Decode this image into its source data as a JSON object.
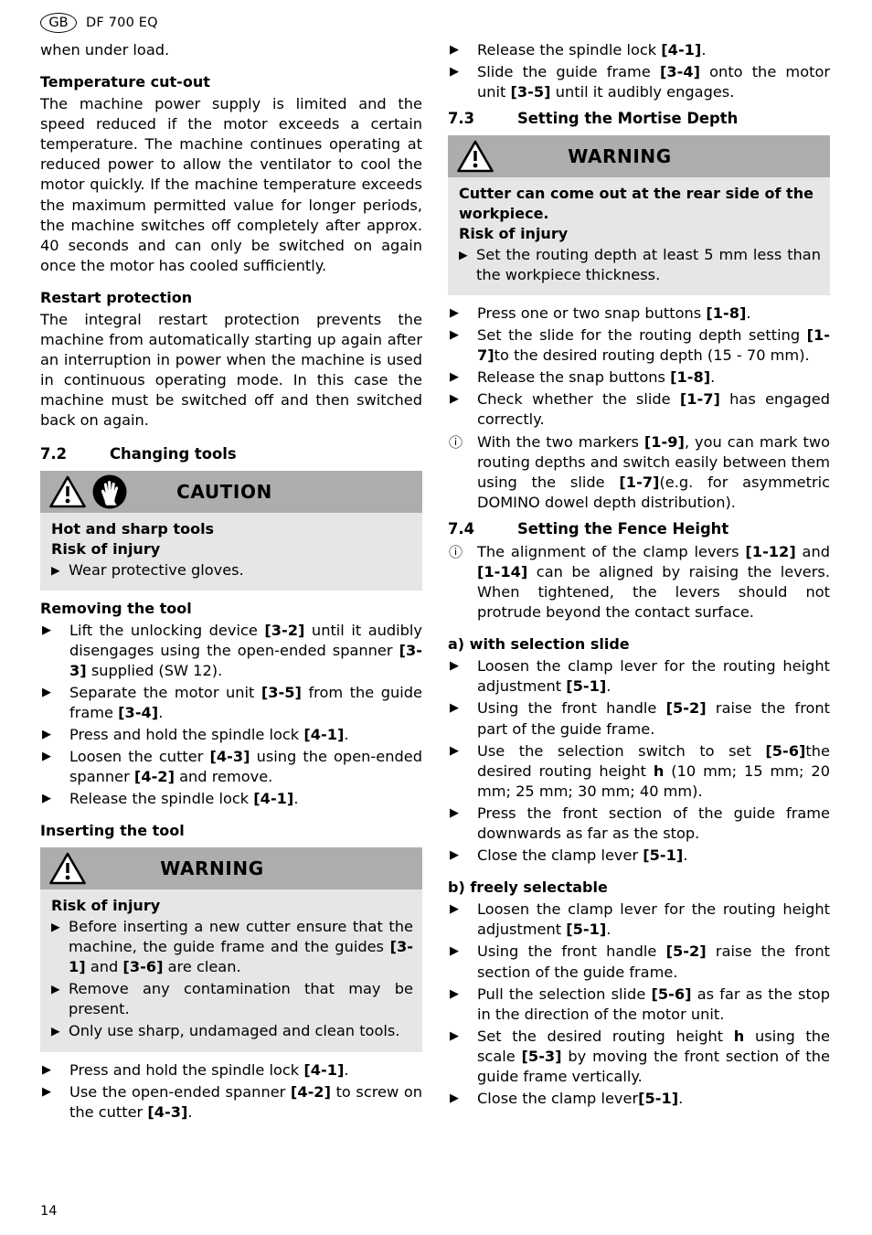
{
  "header": {
    "locale_code": "GB",
    "model": "DF 700 EQ"
  },
  "page_number": "14",
  "colors": {
    "alert_header_bg": "#adadad",
    "alert_body_bg": "#e6e6e6",
    "text": "#000000"
  },
  "left_column": {
    "continued_text": "when under load.",
    "temperature_cutout": {
      "heading": "Temperature cut-out",
      "paragraph": "The machine power supply is limited and the speed reduced if the motor exceeds a certain temperature. The machine continues operating at reduced power to allow the ventilator to cool the motor quickly. If the machine temperature exceeds the maximum permitted value for longer periods, the machine switches off completely after approx. 40 seconds and can only be switched on again once the motor has cooled sufficiently."
    },
    "restart_protection": {
      "heading": "Restart protection",
      "paragraph": "The integral restart protection prevents the machine from automatically starting up again after an interruption in power when the machine is used in continuous operating mode. In this case the machine must be switched off and then switched back on again."
    },
    "section_7_2": {
      "number": "7.2",
      "title": "Changing tools"
    },
    "caution_box": {
      "title": "CAUTION",
      "icons": [
        "warning-triangle-icon",
        "protective-gloves-icon"
      ],
      "bold_lines": [
        "Hot and sharp tools",
        "Risk of injury"
      ],
      "bullets": [
        {
          "marker": "triangle",
          "text": "Wear protective gloves."
        }
      ]
    },
    "removing_the_tool": {
      "heading": "Removing the tool",
      "bullets": [
        {
          "marker": "triangle",
          "html": "Lift the unlocking device <b>[3-2]</b> until it audibly disengages using the open-ended spanner <b>[3-3]</b> supplied (SW 12)."
        },
        {
          "marker": "triangle",
          "html": "Separate the motor unit <b>[3-5]</b> from the guide frame <b>[3-4]</b>."
        },
        {
          "marker": "triangle",
          "html": "Press and hold the spindle lock <b>[4-1]</b>."
        },
        {
          "marker": "triangle",
          "html": "Loosen the cutter <b>[4-3]</b> using the open-ended spanner <b>[4-2]</b> and remove."
        },
        {
          "marker": "triangle",
          "html": "Release the spindle lock <b>[4-1]</b>."
        }
      ]
    },
    "inserting_the_tool": {
      "heading": "Inserting the tool",
      "warning_box": {
        "title": "WARNING",
        "icons": [
          "warning-triangle-icon"
        ],
        "bold_lines": [
          "Risk of injury"
        ],
        "bullets": [
          {
            "marker": "triangle",
            "html": "Before inserting a new cutter ensure that the machine, the guide frame and the guides <b>[3-1]</b> and <b>[3-6]</b> are clean."
          },
          {
            "marker": "triangle",
            "html": "Remove any contamination that may be present."
          },
          {
            "marker": "triangle",
            "html": "Only use sharp, undamaged and clean tools."
          }
        ]
      },
      "bullets": [
        {
          "marker": "triangle",
          "html": "Press and hold the spindle lock <b>[4-1]</b>."
        },
        {
          "marker": "triangle",
          "html": "Use the open-ended spanner <b>[4-2]</b> to screw on the cutter <b>[4-3]</b>."
        }
      ]
    }
  },
  "right_column": {
    "top_bullets": [
      {
        "marker": "triangle",
        "html": "Release the spindle lock <b>[4-1]</b>."
      },
      {
        "marker": "triangle",
        "html": "Slide the guide frame <b>[3-4]</b> onto the motor unit <b>[3-5]</b> until it audibly engages."
      }
    ],
    "section_7_3": {
      "number": "7.3",
      "title": "Setting the Mortise Depth"
    },
    "warning_box": {
      "title": "WARNING",
      "icons": [
        "warning-triangle-icon"
      ],
      "bold_lines": [
        "Cutter can come out at the rear side of the workpiece.",
        "Risk of injury"
      ],
      "bullets": [
        {
          "marker": "triangle",
          "html": "Set the routing depth at least 5 mm less than the workpiece thickness."
        }
      ]
    },
    "mortise_depth_bullets": [
      {
        "marker": "triangle",
        "html": "Press one or two snap buttons <b>[1-8]</b>."
      },
      {
        "marker": "triangle",
        "html": "Set the slide for the routing depth setting <b>[1-7]</b>to the desired routing depth (15 - 70 mm)."
      },
      {
        "marker": "triangle",
        "html": "Release the snap buttons <b>[1-8]</b>."
      },
      {
        "marker": "triangle",
        "html": "Check whether the slide <b>[1-7]</b> has engaged correctly."
      },
      {
        "marker": "info",
        "html": "With the two markers <b>[1-9]</b>, you can mark two routing depths and switch easily between them using the slide <b>[1-7]</b>(e.g. for asymmetric DOMINO dowel depth distribution)."
      }
    ],
    "section_7_4": {
      "number": "7.4",
      "title": "Setting the Fence Height"
    },
    "fence_height_note": [
      {
        "marker": "info",
        "html": "The alignment of the clamp levers <b>[1-12]</b> and <b>[1-14]</b> can be aligned by raising the levers. When tightened, the levers should not protrude beyond the contact surface."
      }
    ],
    "option_a": {
      "heading": "a) with selection slide",
      "bullets": [
        {
          "marker": "triangle",
          "html": "Loosen the clamp lever for the routing height adjustment <b>[5-1]</b>."
        },
        {
          "marker": "triangle",
          "html": "Using the front handle <b>[5-2]</b> raise the front part of the guide frame."
        },
        {
          "marker": "triangle",
          "html": "Use the selection switch to set <b>[5-6]</b>the desired routing height <b>h</b> (10 mm; 15 mm; 20 mm; 25 mm; 30 mm; 40 mm)."
        },
        {
          "marker": "triangle",
          "html": "Press the front section of the guide frame downwards as far as the stop."
        },
        {
          "marker": "triangle",
          "html": "Close the clamp lever <b>[5-1]</b>."
        }
      ]
    },
    "option_b": {
      "heading": "b) freely selectable",
      "bullets": [
        {
          "marker": "triangle",
          "html": "Loosen the clamp lever for the routing height adjustment <b>[5-1]</b>."
        },
        {
          "marker": "triangle",
          "html": "Using the front handle <b>[5-2]</b> raise the front section of the guide frame."
        },
        {
          "marker": "triangle",
          "html": "Pull the selection slide <b>[5-6]</b> as far as the stop in the direction of the motor unit."
        },
        {
          "marker": "triangle",
          "html": "Set the desired routing height <b>h</b> using the scale <b>[5-3]</b> by moving the front section of the guide frame vertically."
        },
        {
          "marker": "triangle",
          "html": "Close the clamp lever<b>[5-1]</b>."
        }
      ]
    }
  },
  "markers": {
    "triangle": "▶",
    "info": "ⓘ"
  }
}
